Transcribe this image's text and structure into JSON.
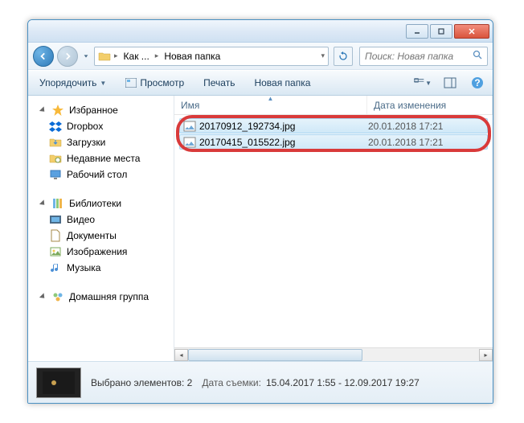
{
  "titlebar": {},
  "nav": {
    "crumb1": "Как ...",
    "crumb2": "Новая папка",
    "search_placeholder": "Поиск: Новая папка"
  },
  "toolbar": {
    "organize": "Упорядочить",
    "preview": "Просмотр",
    "print": "Печать",
    "newfolder": "Новая папка"
  },
  "sidebar": {
    "favorites": "Избранное",
    "items_fav": [
      "Dropbox",
      "Загрузки",
      "Недавние места",
      "Рабочий стол"
    ],
    "libraries": "Библиотеки",
    "items_lib": [
      "Видео",
      "Документы",
      "Изображения",
      "Музыка"
    ],
    "homegroup": "Домашняя группа"
  },
  "columns": {
    "name": "Имя",
    "date": "Дата изменения"
  },
  "files": [
    {
      "name": "20170912_192734.jpg",
      "date": "20.01.2018 17:21"
    },
    {
      "name": "20170415_015522.jpg",
      "date": "20.01.2018 17:21"
    }
  ],
  "details": {
    "selected_label": "Выбрано элементов: 2",
    "shot_label": "Дата съемки:",
    "shot_value": "15.04.2017 1:55 - 12.09.2017 19:27"
  }
}
